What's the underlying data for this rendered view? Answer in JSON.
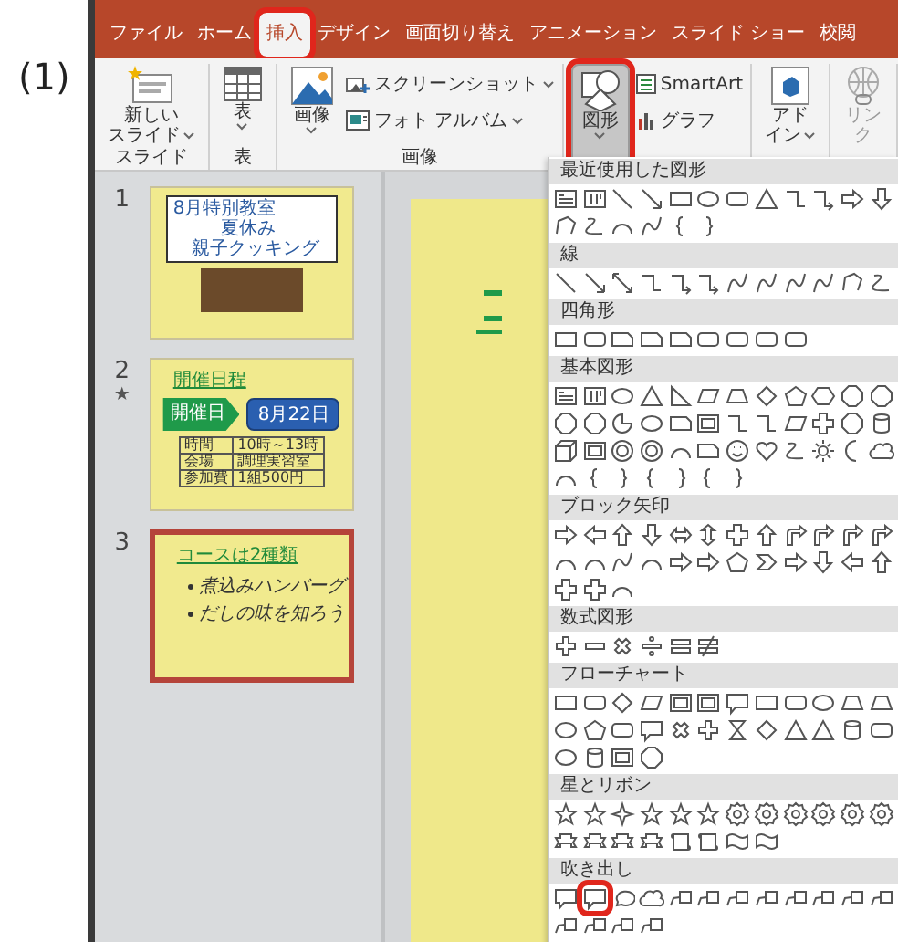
{
  "figure_label": "(1)",
  "tabs": [
    {
      "label": "ファイル",
      "selected": false,
      "highlighted": false
    },
    {
      "label": "ホーム",
      "selected": false,
      "highlighted": false
    },
    {
      "label": "挿入",
      "selected": true,
      "highlighted": true
    },
    {
      "label": "デザイン",
      "selected": false,
      "highlighted": false
    },
    {
      "label": "画面切り替え",
      "selected": false,
      "highlighted": false
    },
    {
      "label": "アニメーション",
      "selected": false,
      "highlighted": false
    },
    {
      "label": "スライド ショー",
      "selected": false,
      "highlighted": false
    },
    {
      "label": "校閲",
      "selected": false,
      "highlighted": false
    }
  ],
  "ribbon": [
    {
      "label": "スライド",
      "items": [
        {
          "kind": "new-slide",
          "label_lines": [
            "新しい",
            "スライド"
          ],
          "caret": true,
          "pressed": false,
          "highlighted": false,
          "disabled": false
        }
      ]
    },
    {
      "label": "表",
      "items": [
        {
          "kind": "table",
          "label_lines": [
            "表"
          ],
          "caret": true,
          "pressed": false,
          "highlighted": false,
          "disabled": false
        }
      ]
    },
    {
      "label": "画像",
      "items": [
        {
          "kind": "picture",
          "label_lines": [
            "画像"
          ],
          "caret": true,
          "pressed": false,
          "highlighted": false,
          "disabled": false
        },
        {
          "kind": "screenshot",
          "label_lines": [
            "スクリーンショット"
          ],
          "caret": true,
          "pressed": false,
          "highlighted": false,
          "disabled": false
        },
        {
          "kind": "album",
          "label_lines": [
            "フォト アルバム"
          ],
          "caret": true,
          "pressed": false,
          "highlighted": false,
          "disabled": false
        }
      ]
    },
    {
      "items": [
        {
          "kind": "shapes",
          "label_lines": [
            "図形"
          ],
          "caret": true,
          "pressed": true,
          "highlighted": true,
          "disabled": false
        },
        {
          "kind": "smartart",
          "label_lines": [
            "SmartArt"
          ],
          "caret": false,
          "pressed": false,
          "highlighted": false,
          "disabled": false
        },
        {
          "kind": "chart",
          "label_lines": [
            "グラフ"
          ],
          "caret": false,
          "pressed": false,
          "highlighted": false,
          "disabled": false
        }
      ]
    },
    {
      "items": [
        {
          "kind": "addin",
          "label_lines": [
            "アド",
            "イン"
          ],
          "caret": true,
          "pressed": false,
          "highlighted": false,
          "disabled": false
        }
      ]
    },
    {
      "items": [
        {
          "kind": "link",
          "label_lines": [
            "リン",
            "ク"
          ],
          "caret": false,
          "pressed": false,
          "highlighted": false,
          "disabled": true
        }
      ]
    }
  ],
  "slides": [
    {
      "number": "1",
      "selected": false,
      "kind": "title",
      "title_lines": [
        "8月特別教室",
        "夏休み",
        "親子クッキング"
      ]
    },
    {
      "number": "2",
      "mark": "★",
      "selected": false,
      "kind": "schedule",
      "heading": "開催日程",
      "arrow": "開催日",
      "date": "8月22日",
      "table": [
        [
          "時間",
          "10時～13時"
        ],
        [
          "会場",
          "調理実習室"
        ],
        [
          "参加費",
          "1組500円"
        ]
      ]
    },
    {
      "number": "3",
      "selected": true,
      "kind": "bullets",
      "heading": "コースは2種類",
      "bullets": [
        "煮込みハンバーグ",
        "だしの味を知ろう"
      ]
    }
  ],
  "shape_gallery": [
    {
      "label": "最近使用した図形",
      "shapes": [
        {
          "kind": "textbox"
        },
        {
          "kind": "vtextbox"
        },
        {
          "kind": "line"
        },
        {
          "kind": "arrowline"
        },
        {
          "kind": "rect"
        },
        {
          "kind": "ellipse"
        },
        {
          "kind": "rrect"
        },
        {
          "kind": "triangle"
        },
        {
          "kind": "elbow"
        },
        {
          "kind": "elbowarrow"
        },
        {
          "kind": "arrow-r"
        },
        {
          "kind": "arrow-d"
        },
        {
          "kind": "freeform"
        },
        {
          "kind": "scribble"
        },
        {
          "kind": "arc"
        },
        {
          "kind": "curve"
        },
        {
          "kind": "lbrace"
        },
        {
          "kind": "rbrace"
        }
      ]
    },
    {
      "label": "線",
      "shapes": [
        {
          "kind": "line"
        },
        {
          "kind": "arrowline"
        },
        {
          "kind": "dblarrow"
        },
        {
          "kind": "elbow"
        },
        {
          "kind": "elbowarrow"
        },
        {
          "kind": "elbowarrow"
        },
        {
          "kind": "curve"
        },
        {
          "kind": "curve"
        },
        {
          "kind": "curve"
        },
        {
          "kind": "curve"
        },
        {
          "kind": "freeform"
        },
        {
          "kind": "scribble"
        }
      ]
    },
    {
      "label": "四角形",
      "shapes": [
        {
          "kind": "rect"
        },
        {
          "kind": "rrect"
        },
        {
          "kind": "snip"
        },
        {
          "kind": "snip"
        },
        {
          "kind": "snip"
        },
        {
          "kind": "rrect"
        },
        {
          "kind": "rrect"
        },
        {
          "kind": "rrect"
        },
        {
          "kind": "rrect"
        }
      ]
    },
    {
      "label": "基本図形",
      "shapes": [
        {
          "kind": "textbox"
        },
        {
          "kind": "vtextbox"
        },
        {
          "kind": "ellipse"
        },
        {
          "kind": "triangle"
        },
        {
          "kind": "rtriangle"
        },
        {
          "kind": "para"
        },
        {
          "kind": "trap"
        },
        {
          "kind": "diamond"
        },
        {
          "kind": "pentagon"
        },
        {
          "kind": "hexagon"
        },
        {
          "kind": "octagon"
        },
        {
          "kind": "octagon"
        },
        {
          "kind": "octagon"
        },
        {
          "kind": "octagon"
        },
        {
          "kind": "pie"
        },
        {
          "kind": "ellipse"
        },
        {
          "kind": "snip"
        },
        {
          "kind": "frame"
        },
        {
          "kind": "elbow"
        },
        {
          "kind": "elbow"
        },
        {
          "kind": "para"
        },
        {
          "kind": "cross"
        },
        {
          "kind": "octagon"
        },
        {
          "kind": "can"
        },
        {
          "kind": "cube"
        },
        {
          "kind": "frame"
        },
        {
          "kind": "donut"
        },
        {
          "kind": "donut"
        },
        {
          "kind": "arc"
        },
        {
          "kind": "snip"
        },
        {
          "kind": "smile"
        },
        {
          "kind": "heart"
        },
        {
          "kind": "scribble"
        },
        {
          "kind": "sun"
        },
        {
          "kind": "moon"
        },
        {
          "kind": "cloud"
        },
        {
          "kind": "arc"
        },
        {
          "kind": "lbrace"
        },
        {
          "kind": "rbrace"
        },
        {
          "kind": "lbrace"
        },
        {
          "kind": "rbrace"
        },
        {
          "kind": "lbrace"
        },
        {
          "kind": "rbrace"
        }
      ]
    },
    {
      "label": "ブロック矢印",
      "shapes": [
        {
          "kind": "arrow-r"
        },
        {
          "kind": "arrow-l"
        },
        {
          "kind": "arrow-u"
        },
        {
          "kind": "arrow-d"
        },
        {
          "kind": "arrow-lr"
        },
        {
          "kind": "arrow-ud"
        },
        {
          "kind": "cross"
        },
        {
          "kind": "arrow-u"
        },
        {
          "kind": "bent"
        },
        {
          "kind": "bent"
        },
        {
          "kind": "bent"
        },
        {
          "kind": "bent"
        },
        {
          "kind": "arc"
        },
        {
          "kind": "arc"
        },
        {
          "kind": "curve"
        },
        {
          "kind": "arc"
        },
        {
          "kind": "arrow-r"
        },
        {
          "kind": "arrow-r"
        },
        {
          "kind": "pentagon"
        },
        {
          "kind": "chevron"
        },
        {
          "kind": "arrow-r"
        },
        {
          "kind": "arrow-d"
        },
        {
          "kind": "arrow-l"
        },
        {
          "kind": "arrow-u"
        },
        {
          "kind": "cross"
        },
        {
          "kind": "cross"
        },
        {
          "kind": "arc"
        }
      ]
    },
    {
      "label": "数式図形",
      "shapes": [
        {
          "kind": "plus"
        },
        {
          "kind": "minus"
        },
        {
          "kind": "mult"
        },
        {
          "kind": "div"
        },
        {
          "kind": "equal"
        },
        {
          "kind": "notequal"
        }
      ]
    },
    {
      "label": "フローチャート",
      "shapes": [
        {
          "kind": "rect"
        },
        {
          "kind": "rrect"
        },
        {
          "kind": "diamond"
        },
        {
          "kind": "para"
        },
        {
          "kind": "frame"
        },
        {
          "kind": "frame"
        },
        {
          "kind": "callout-rect"
        },
        {
          "kind": "rect"
        },
        {
          "kind": "rrect"
        },
        {
          "kind": "ellipse"
        },
        {
          "kind": "trap"
        },
        {
          "kind": "trap"
        },
        {
          "kind": "ellipse"
        },
        {
          "kind": "pentagon"
        },
        {
          "kind": "rrect"
        },
        {
          "kind": "callout-rect"
        },
        {
          "kind": "mult"
        },
        {
          "kind": "plus"
        },
        {
          "kind": "hourglass"
        },
        {
          "kind": "diamond"
        },
        {
          "kind": "triangle"
        },
        {
          "kind": "triangle"
        },
        {
          "kind": "can"
        },
        {
          "kind": "rrect"
        },
        {
          "kind": "ellipse"
        },
        {
          "kind": "can"
        },
        {
          "kind": "frame"
        },
        {
          "kind": "octagon"
        }
      ]
    },
    {
      "label": "星とリボン",
      "shapes": [
        {
          "kind": "star"
        },
        {
          "kind": "star"
        },
        {
          "kind": "star4"
        },
        {
          "kind": "star"
        },
        {
          "kind": "star"
        },
        {
          "kind": "star"
        },
        {
          "kind": "seal"
        },
        {
          "kind": "seal"
        },
        {
          "kind": "seal"
        },
        {
          "kind": "seal"
        },
        {
          "kind": "seal"
        },
        {
          "kind": "seal"
        },
        {
          "kind": "ribbon"
        },
        {
          "kind": "ribbon"
        },
        {
          "kind": "ribbon"
        },
        {
          "kind": "ribbon"
        },
        {
          "kind": "scroll"
        },
        {
          "kind": "scroll"
        },
        {
          "kind": "wave"
        },
        {
          "kind": "wave"
        }
      ]
    },
    {
      "label": "吹き出し",
      "shapes": [
        {
          "kind": "callout-rect",
          "highlighted": false
        },
        {
          "kind": "callout-rect",
          "highlighted": true
        },
        {
          "kind": "callout-oval",
          "highlighted": false
        },
        {
          "kind": "cloud",
          "highlighted": false
        },
        {
          "kind": "callout-line",
          "highlighted": false
        },
        {
          "kind": "callout-line",
          "highlighted": false
        },
        {
          "kind": "callout-line",
          "highlighted": false
        },
        {
          "kind": "callout-line",
          "highlighted": false
        },
        {
          "kind": "callout-line",
          "highlighted": false
        },
        {
          "kind": "callout-line",
          "highlighted": false
        },
        {
          "kind": "callout-line",
          "highlighted": false
        },
        {
          "kind": "callout-line",
          "highlighted": false
        },
        {
          "kind": "callout-line",
          "highlighted": false
        },
        {
          "kind": "callout-line",
          "highlighted": false
        },
        {
          "kind": "callout-line",
          "highlighted": false
        },
        {
          "kind": "callout-line",
          "highlighted": false
        }
      ]
    }
  ]
}
